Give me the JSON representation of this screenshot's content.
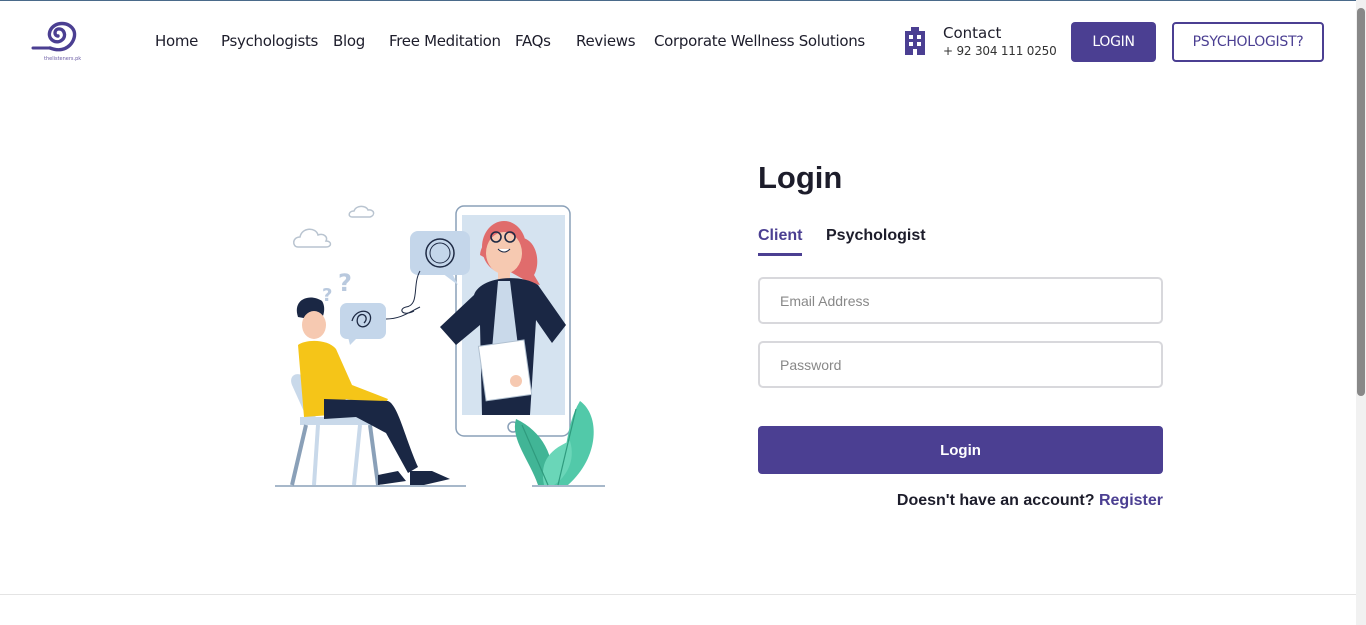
{
  "brand": {
    "logo_text": "thelisteners.pk",
    "accent_color": "#4b3f92"
  },
  "nav": {
    "items": [
      "Home",
      "Psychologists",
      "Blog",
      "Free Meditation",
      "FAQs",
      "Reviews",
      "Corporate Wellness Solutions"
    ]
  },
  "contact": {
    "icon": "building-icon",
    "title": "Contact",
    "phone": "+ 92 304 111 0250"
  },
  "header_buttons": {
    "login": "LOGIN",
    "psychologist": "PSYCHOLOGIST?"
  },
  "login": {
    "title": "Login",
    "tabs": [
      "Client",
      "Psychologist"
    ],
    "active_tab": "Client",
    "email_placeholder": "Email Address",
    "email_value": "",
    "password_placeholder": "Password",
    "password_value": "",
    "submit_label": "Login",
    "register_prompt": "Doesn't have an account?",
    "register_link": "Register"
  }
}
